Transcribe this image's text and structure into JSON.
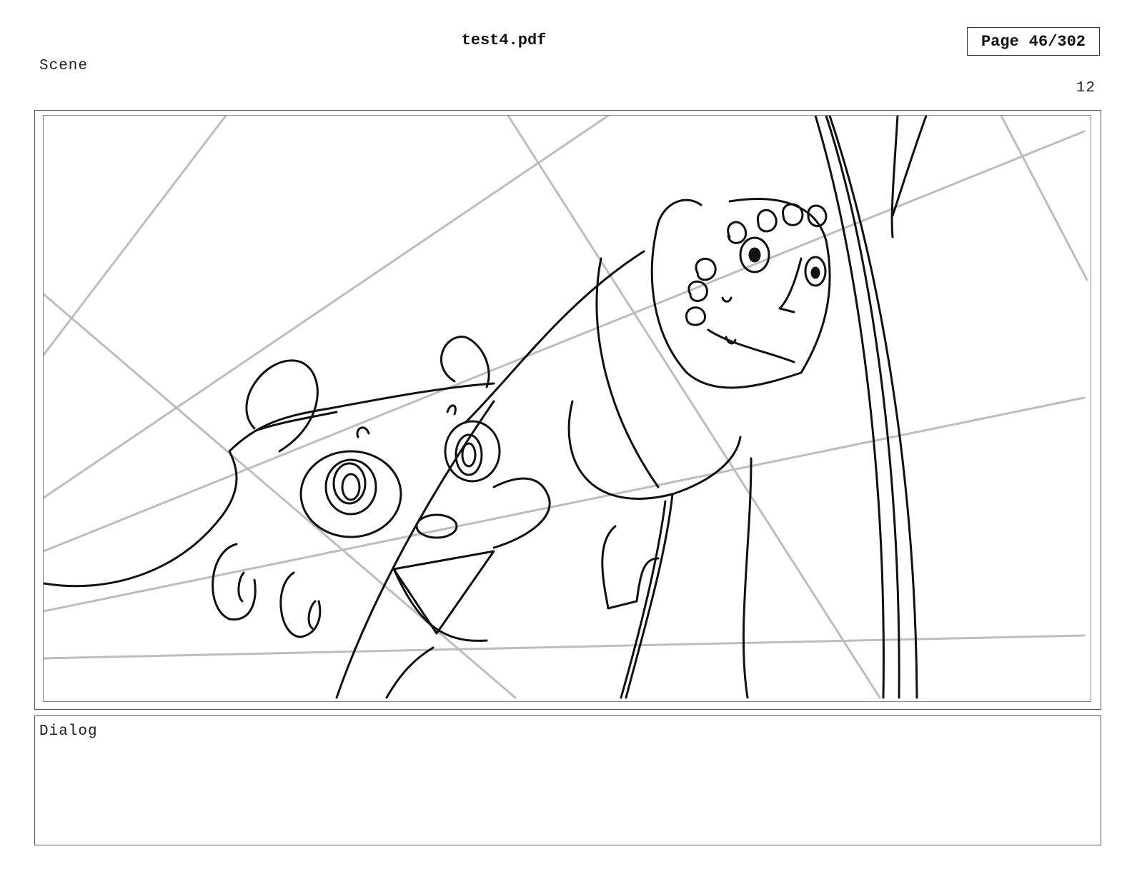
{
  "document": {
    "title": "test4.pdf",
    "page_label": "Page",
    "page_value": "46/302"
  },
  "scene": {
    "label": "Scene",
    "panel_number": "12"
  },
  "panel": {
    "image_description": "Rough storyboard sketch of two cartoon characters"
  },
  "dialog": {
    "label": "Dialog",
    "text": ""
  }
}
